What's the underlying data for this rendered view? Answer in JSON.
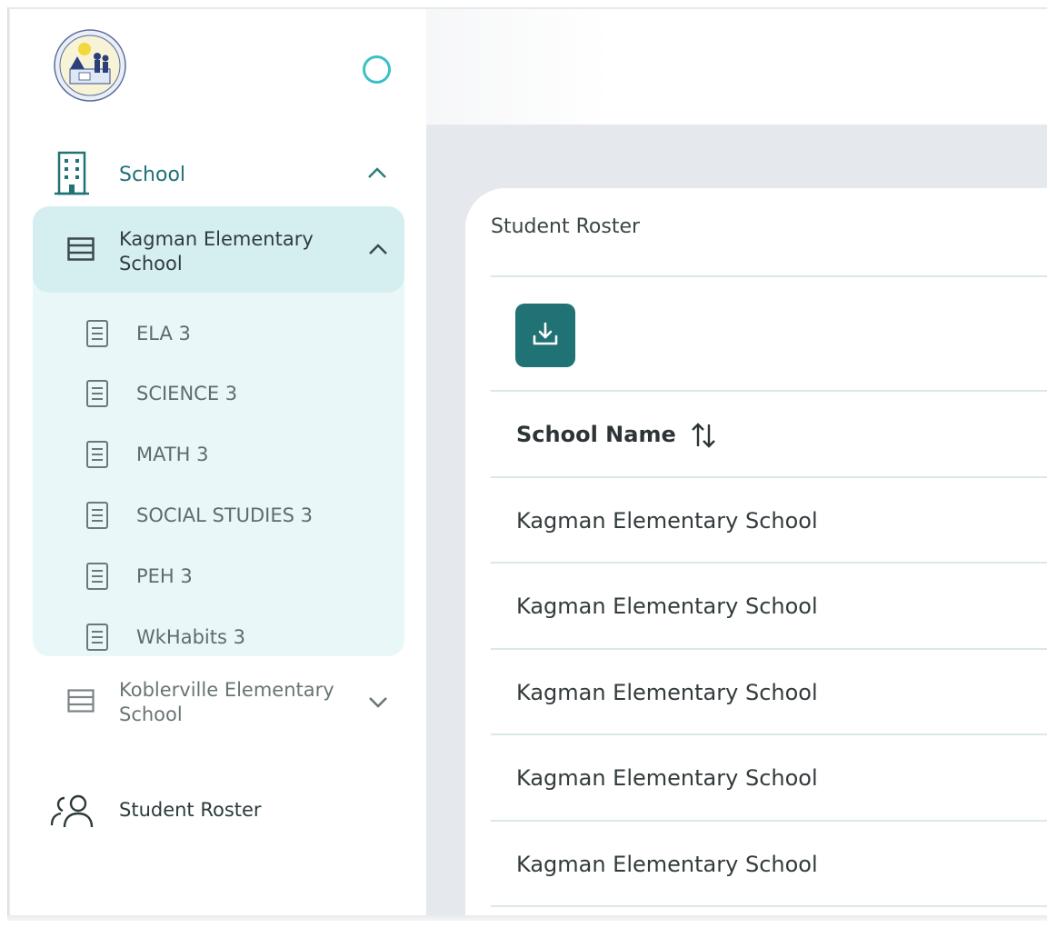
{
  "sidebar": {
    "school_label": "School",
    "schools": [
      {
        "name": "Kagman Elementary School",
        "expanded": true,
        "courses": [
          "ELA 3",
          "SCIENCE 3",
          "MATH 3",
          "SOCIAL STUDIES 3",
          "PEH 3",
          "WkHabits 3"
        ]
      },
      {
        "name": "Koblerville Elementary School",
        "expanded": false
      }
    ],
    "student_roster_label": "Student Roster"
  },
  "main": {
    "card_title": "Student Roster",
    "table": {
      "columns": [
        "School Name"
      ],
      "rows": [
        [
          "Kagman Elementary School"
        ],
        [
          "Kagman Elementary School"
        ],
        [
          "Kagman Elementary School"
        ],
        [
          "Kagman Elementary School"
        ],
        [
          "Kagman Elementary School"
        ]
      ]
    }
  },
  "icons": {
    "logo": "school-seal-logo",
    "toggle": "sidebar-toggle-ring",
    "school": "building-icon",
    "school_item": "list-icon",
    "course": "document-icon",
    "roster": "users-icon",
    "download": "download-icon",
    "sort": "sort-arrows-icon"
  },
  "colors": {
    "accent": "#217274",
    "accent_text": "#1f7275",
    "ring": "#3cc0c6",
    "group_bg": "#eaf7f8",
    "group_header_bg": "#d5eff1",
    "main_bg": "#e5e8ed"
  }
}
